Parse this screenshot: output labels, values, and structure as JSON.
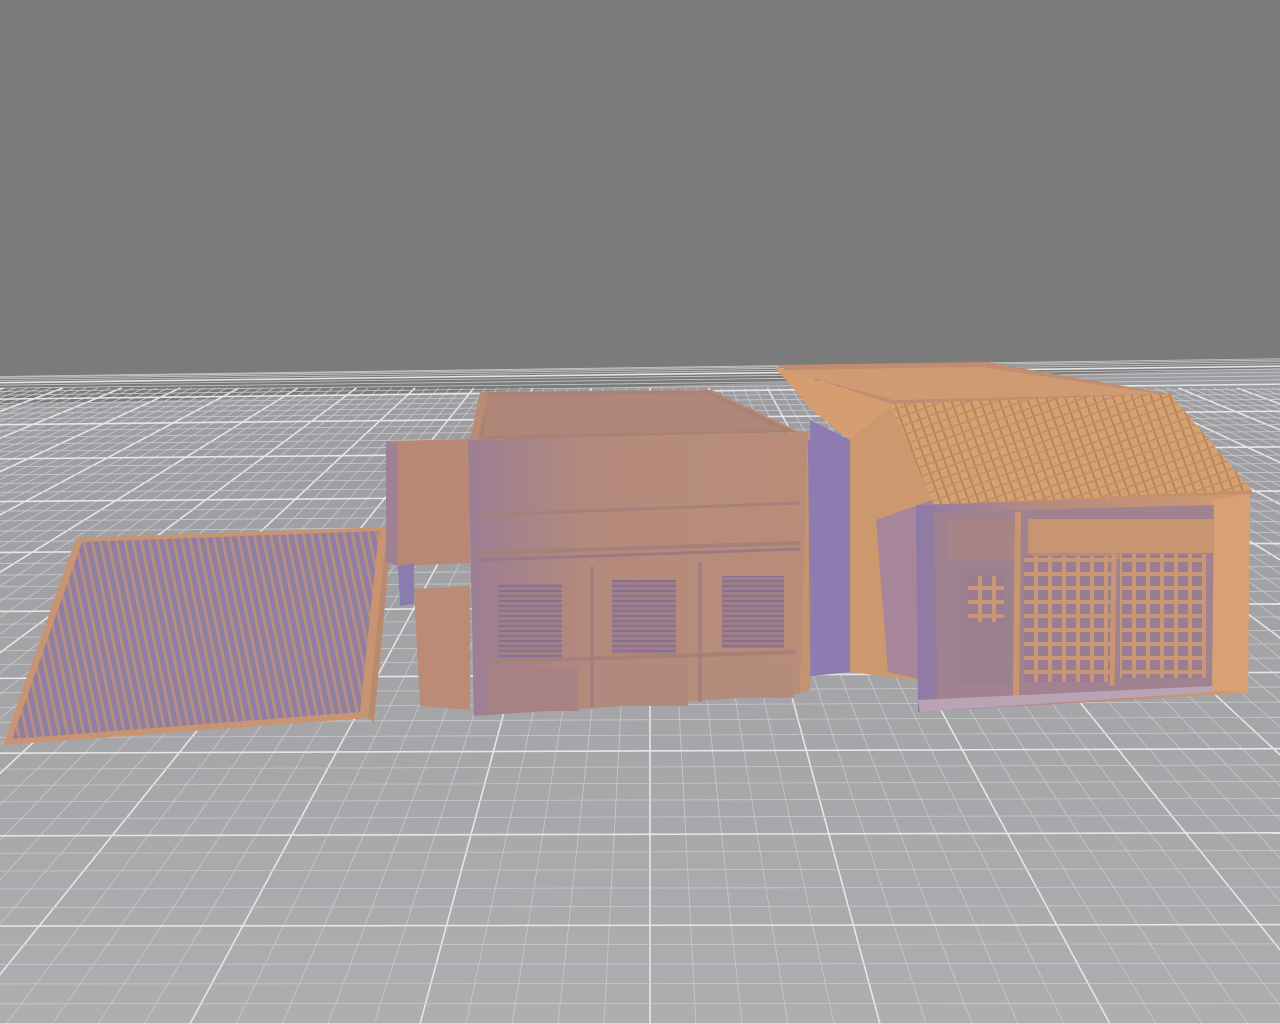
{
  "viewport": {
    "background_color": "#7b7b7b",
    "grid": true,
    "ground_color": "#a9a9ab",
    "grid_line_color": "#c9c9cc",
    "grid_major_line_color": "#e6e6e8"
  },
  "scene": {
    "objects": [
      {
        "name": "loose-roof-panel",
        "color": "#ad8a78",
        "shade_color": "#8b7aa6"
      },
      {
        "name": "two-storey-shophouse-shell",
        "color": "#bc8d74",
        "shade_color": "#9a7d96"
      },
      {
        "name": "tiled-roof-shophouse",
        "color": "#d19b6f",
        "shade_color": "#8e7cab"
      }
    ]
  }
}
